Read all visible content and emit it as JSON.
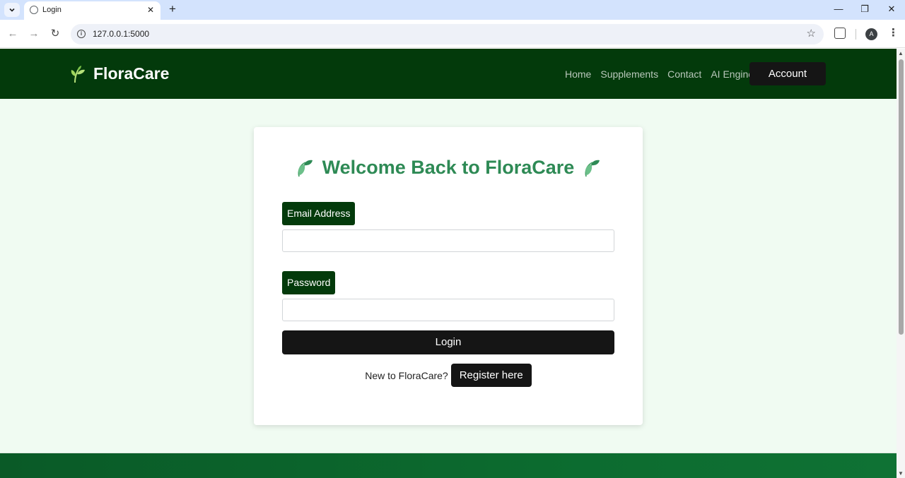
{
  "browser": {
    "tab_title": "Login",
    "url": "127.0.0.1:5000",
    "profile_initial": "A"
  },
  "header": {
    "brand": "FloraCare",
    "nav": [
      "Home",
      "Supplements",
      "Contact",
      "AI Engine"
    ],
    "account_label": "Account"
  },
  "login": {
    "title": "Welcome Back to FloraCare",
    "email_label": "Email Address",
    "email_value": "",
    "password_label": "Password",
    "password_value": "",
    "submit_label": "Login",
    "register_prompt": "New to FloraCare?",
    "register_label": "Register here"
  },
  "colors": {
    "header_bg": "#033a0b",
    "page_bg": "#f0fbf2",
    "title_green": "#2e8a55",
    "button_dark": "#151515"
  },
  "icons": {
    "brand": "herb-icon",
    "title_left": "leaf-icon",
    "title_right": "leaf-icon"
  }
}
